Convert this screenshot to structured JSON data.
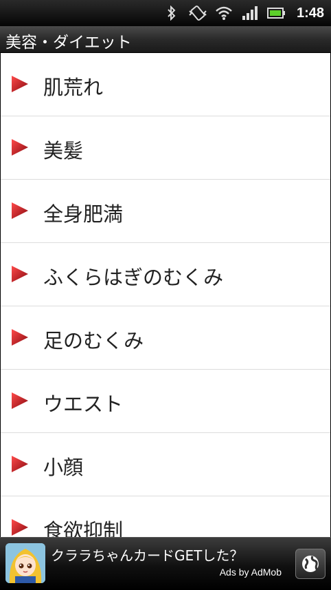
{
  "status_bar": {
    "time": "1:48",
    "icons": [
      "bluetooth-icon",
      "vibrate-icon",
      "wifi-icon",
      "signal-icon",
      "battery-icon"
    ]
  },
  "title_bar": {
    "title": "美容・ダイエット"
  },
  "list": {
    "items": [
      {
        "label": "肌荒れ"
      },
      {
        "label": "美髪"
      },
      {
        "label": "全身肥満"
      },
      {
        "label": "ふくらはぎのむくみ"
      },
      {
        "label": "足のむくみ"
      },
      {
        "label": "ウエスト"
      },
      {
        "label": "小顔"
      },
      {
        "label": "食欲抑制"
      }
    ],
    "arrow_color": "#c8141e"
  },
  "ad": {
    "text": "クララちゃんカードGETした？",
    "by": "Ads by AdMob"
  }
}
